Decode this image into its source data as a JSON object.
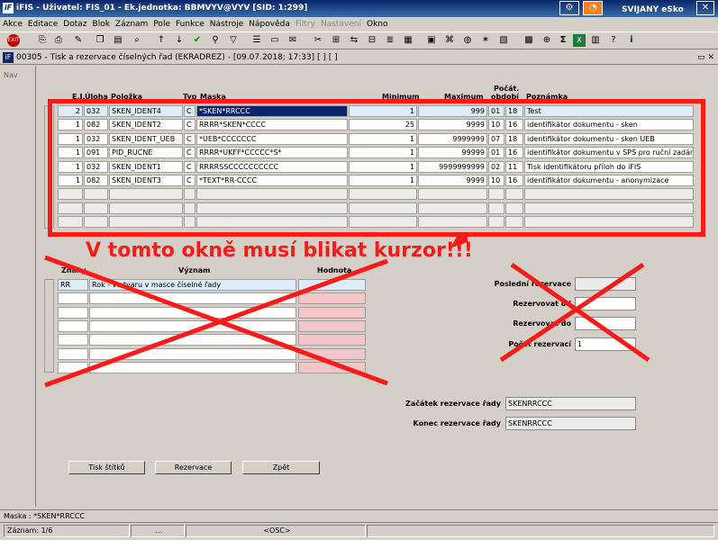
{
  "window": {
    "title": "iFIS - Uživatel: FIS_01 - Ek.jednotka: BBMVYV@VYV   [SID: 1:299]",
    "app_icon": "iF",
    "ext_label": "SVIJANY eSko"
  },
  "menu": [
    "Akce",
    "Editace",
    "Dotaz",
    "Blok",
    "Záznam",
    "Pole",
    "Funkce",
    "Nástroje",
    "Nápověda",
    "Filtry",
    "Nastavení",
    "Okno"
  ],
  "menu_disabled": [
    "Filtry",
    "Nastavení"
  ],
  "toolbar_icons": [
    "exit-icon",
    "save-icon",
    "print-icon",
    "scissors-icon",
    "copy-icon",
    "paste-icon",
    "sort-asc-icon",
    "sort-desc-icon",
    "check-icon",
    "query-icon",
    "filter-icon",
    "cut-icon",
    "insert-icon",
    "delete-icon",
    "up-icon",
    "down-icon",
    "help-icon",
    "calc-icon",
    "sum-icon",
    "excel-icon",
    "chart-icon",
    "info-icon"
  ],
  "form": {
    "title": "00305 - Tisk a rezervace číselných řad (EKRADREZ) - [09.07.2018; 17:33]  [ ]  [ ]",
    "nav_label": "Nav",
    "headers": {
      "el": "E.I.",
      "uloha": "Úloha",
      "polozka": "Položka",
      "typ": "Typ",
      "maska": "Maska",
      "minimum": "Minimum",
      "maximum": "Maximum",
      "pocat": "Počát.",
      "obdobi": "období",
      "poznamka": "Poznámka"
    },
    "rows": [
      {
        "el": "2",
        "uloha": "032",
        "polozka": "SKEN_IDENT4",
        "typ": "C",
        "maska": "*SKEN*RRCCC",
        "minimum": "1",
        "maximum": "999",
        "a": "01",
        "b": "18",
        "poznamka": "Test"
      },
      {
        "el": "1",
        "uloha": "082",
        "polozka": "SKEN_IDENT2",
        "typ": "C",
        "maska": "RRRR*SKEN*CCCC",
        "minimum": "25",
        "maximum": "9999",
        "a": "10",
        "b": "16",
        "poznamka": "identifikátor dokumentu - sken"
      },
      {
        "el": "1",
        "uloha": "032",
        "polozka": "SKEN_IDENT_UEB",
        "typ": "C",
        "maska": "*UEB*CCCCCCC",
        "minimum": "1",
        "maximum": "9999999",
        "a": "07",
        "b": "18",
        "poznamka": "identifikátor dokumentu - sken UEB"
      },
      {
        "el": "1",
        "uloha": "091",
        "polozka": "PID_RUCNE",
        "typ": "C",
        "maska": "RRRR*UKFF*CCCCC*S*",
        "minimum": "1",
        "maximum": "99999",
        "a": "01",
        "b": "16",
        "poznamka": "identifikátor dokumentu v SPS pro ruční zadání"
      },
      {
        "el": "1",
        "uloha": "032",
        "polozka": "SKEN_IDENT1",
        "typ": "C",
        "maska": "RRRRSSCCCCCCCCCC",
        "minimum": "1",
        "maximum": "9999999999",
        "a": "02",
        "b": "11",
        "poznamka": "Tisk identifikátoru příloh do iFIS"
      },
      {
        "el": "1",
        "uloha": "082",
        "polozka": "SKEN_IDENT3",
        "typ": "C",
        "maska": "*TEXT*RR-CCCC",
        "minimum": "1",
        "maximum": "9999",
        "a": "10",
        "b": "16",
        "poznamka": "identifikátor dokumentu - anonymizace"
      }
    ],
    "annotation": "V tomto okně musí blikat kurzor!!!",
    "sub_headers": {
      "znaky": "Znaky",
      "vyznam": "Význam",
      "hodnota": "Hodnota"
    },
    "sub_rows": [
      {
        "znaky": "RR",
        "vyznam": "Rok - ve tvaru v masce číselné řady",
        "hodnota": ""
      }
    ],
    "right": {
      "posledni_label": "Poslední rezervace",
      "posledni_value": "",
      "rezervovat_od_label": "Rezervovat od",
      "rezervovat_od_value": "",
      "rezervovat_do_label": "Rezervovat do",
      "rezervovat_do_value": "",
      "pocet_label": "Počet rezervací",
      "pocet_value": "1",
      "zacatek_label": "Začátek rezervace řady",
      "zacatek_value": "SKENRRCCC",
      "konec_label": "Konec rezervace řady",
      "konec_value": "SKENRRCCC"
    },
    "buttons": {
      "tisk": "Tisk štítků",
      "rezervace": "Rezervace",
      "zpet": "Zpět"
    }
  },
  "status": {
    "maska": "Maska : *SKEN*RRCCC",
    "zaznam": "Záznam: 1/6",
    "seg2": "...",
    "osc": "<OSC>"
  },
  "colors": {
    "annotation_red": "#ff1a1a",
    "title_blue": "#0a246a",
    "selected_row": "#ddecf9",
    "pink_cell": "#f3c6c8"
  }
}
